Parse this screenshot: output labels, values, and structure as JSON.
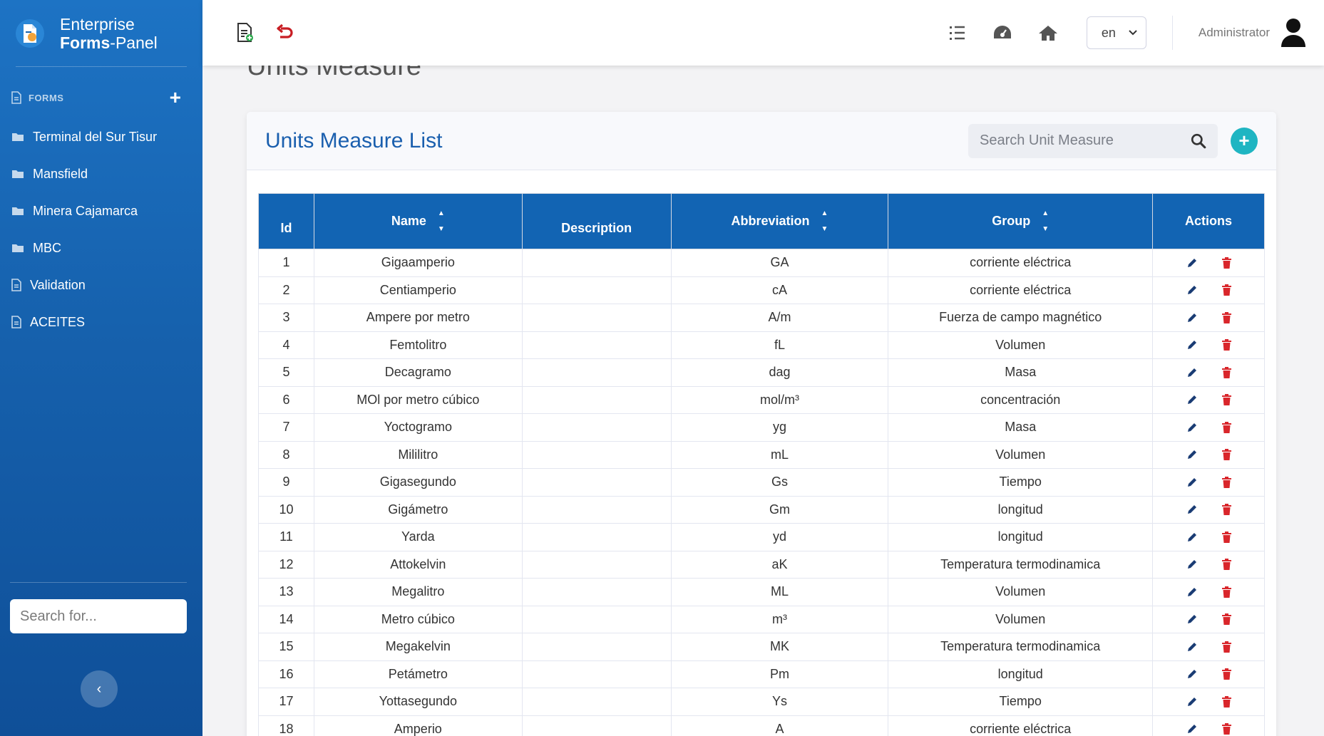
{
  "brand": {
    "line1": "Enterprise",
    "line2_bold": "Forms",
    "line2_rest": "-Panel"
  },
  "sidebar": {
    "section_label": "FORMS",
    "items": [
      {
        "label": "Terminal del Sur Tisur",
        "icon": "folder-icon"
      },
      {
        "label": "Mansfield",
        "icon": "folder-icon"
      },
      {
        "label": "Minera Cajamarca",
        "icon": "folder-icon"
      },
      {
        "label": "MBC",
        "icon": "folder-icon"
      },
      {
        "label": "Validation",
        "icon": "file-icon"
      },
      {
        "label": "ACEITES",
        "icon": "file-icon"
      }
    ],
    "search_placeholder": "Search for..."
  },
  "topbar": {
    "language": "en",
    "user": "Administrator"
  },
  "page": {
    "title": "Units Measure"
  },
  "card": {
    "title": "Units Measure List",
    "search_placeholder": "Search Unit Measure"
  },
  "table": {
    "headers": {
      "id": "Id",
      "name": "Name",
      "description": "Description",
      "abbreviation": "Abbreviation",
      "group": "Group",
      "actions": "Actions"
    },
    "rows": [
      {
        "id": "1",
        "name": "Gigaamperio",
        "description": "",
        "abbr": "GA",
        "group": "corriente eléctrica"
      },
      {
        "id": "2",
        "name": "Centiamperio",
        "description": "",
        "abbr": "cA",
        "group": "corriente eléctrica"
      },
      {
        "id": "3",
        "name": "Ampere por metro",
        "description": "",
        "abbr": "A/m",
        "group": "Fuerza de campo magnético"
      },
      {
        "id": "4",
        "name": "Femtolitro",
        "description": "",
        "abbr": "fL",
        "group": "Volumen"
      },
      {
        "id": "5",
        "name": "Decagramo",
        "description": "",
        "abbr": "dag",
        "group": "Masa"
      },
      {
        "id": "6",
        "name": "MOl por metro cúbico",
        "description": "",
        "abbr": "mol/m³",
        "group": "concentración"
      },
      {
        "id": "7",
        "name": "Yoctogramo",
        "description": "",
        "abbr": "yg",
        "group": "Masa"
      },
      {
        "id": "8",
        "name": "Mililitro",
        "description": "",
        "abbr": "mL",
        "group": "Volumen"
      },
      {
        "id": "9",
        "name": "Gigasegundo",
        "description": "",
        "abbr": "Gs",
        "group": "Tiempo"
      },
      {
        "id": "10",
        "name": "Gigámetro",
        "description": "",
        "abbr": "Gm",
        "group": "longitud"
      },
      {
        "id": "11",
        "name": "Yarda",
        "description": "",
        "abbr": "yd",
        "group": "longitud"
      },
      {
        "id": "12",
        "name": "Attokelvin",
        "description": "",
        "abbr": "aK",
        "group": "Temperatura termodinamica"
      },
      {
        "id": "13",
        "name": "Megalitro",
        "description": "",
        "abbr": "ML",
        "group": "Volumen"
      },
      {
        "id": "14",
        "name": "Metro cúbico",
        "description": "",
        "abbr": "m³",
        "group": "Volumen"
      },
      {
        "id": "15",
        "name": "Megakelvin",
        "description": "",
        "abbr": "MK",
        "group": "Temperatura termodinamica"
      },
      {
        "id": "16",
        "name": "Petámetro",
        "description": "",
        "abbr": "Pm",
        "group": "longitud"
      },
      {
        "id": "17",
        "name": "Yottasegundo",
        "description": "",
        "abbr": "Ys",
        "group": "Tiempo"
      },
      {
        "id": "18",
        "name": "Amperio",
        "description": "",
        "abbr": "A",
        "group": "corriente eléctrica"
      }
    ]
  },
  "colors": {
    "primary": "#1264b3",
    "sidebar": "#1661ad",
    "add": "#1fb5c2",
    "delete": "#d9262b"
  }
}
